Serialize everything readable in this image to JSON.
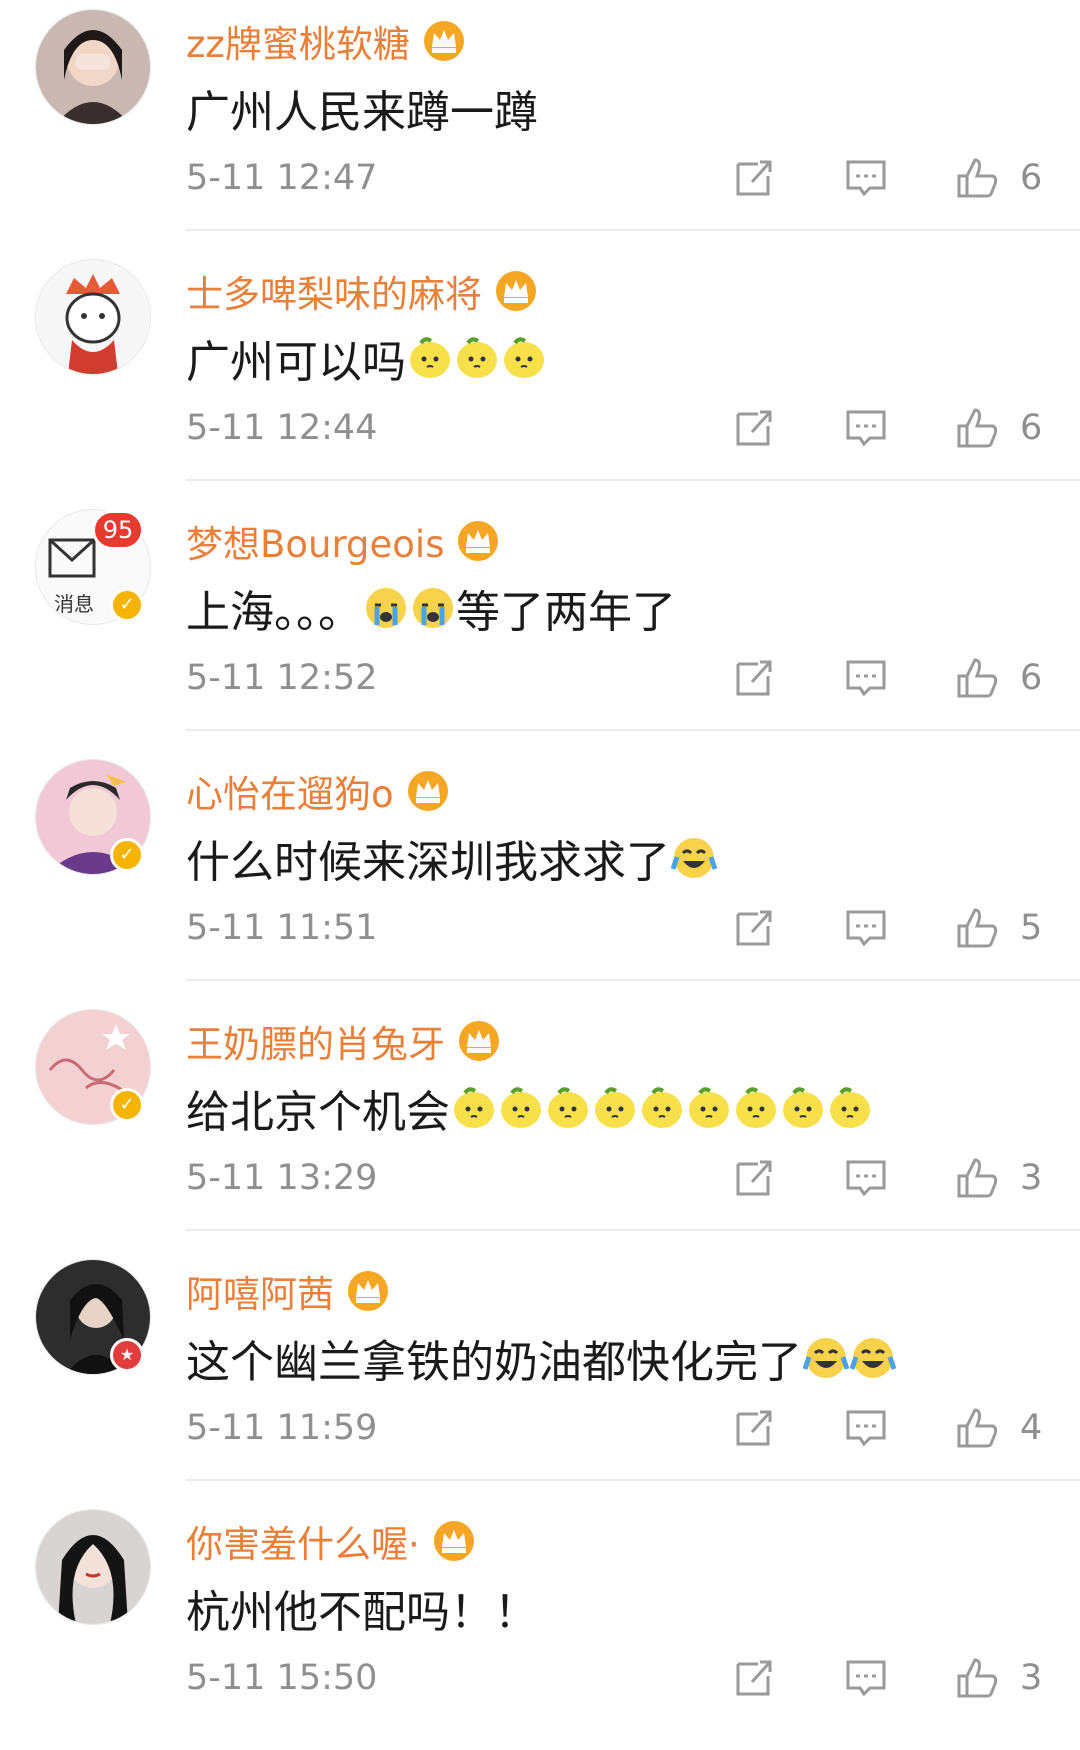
{
  "comments": [
    {
      "username": "zz牌蜜桃软糖",
      "crown_level": "1",
      "content": "广州人民来蹲一蹲",
      "emojis": [],
      "time": "5-11 12:47",
      "likes": "6",
      "avatar": "avatar-girl-covering-face",
      "badge": null
    },
    {
      "username": "士多啤梨味的麻将",
      "crown_level": "",
      "content": "广州可以吗",
      "emojis": [
        "lemon",
        "lemon",
        "lemon"
      ],
      "time": "5-11 12:44",
      "likes": "6",
      "avatar": "avatar-cartoon-king",
      "badge": null
    },
    {
      "username": "梦想Bourgeois",
      "crown_level": "2",
      "content": "上海。。。",
      "emojis": [
        "cry",
        "cry"
      ],
      "content_tail": "等了两年了",
      "time": "5-11 12:52",
      "likes": "6",
      "avatar": "avatar-messages",
      "avatar_label": "消息",
      "avatar_count": "95",
      "badge": "v"
    },
    {
      "username": "心怡在遛狗o",
      "crown_level": "4",
      "content": "什么时候来深圳我求求了",
      "emojis": [
        "laugh-cry"
      ],
      "time": "5-11 11:51",
      "likes": "5",
      "avatar": "avatar-illustration",
      "badge": "v"
    },
    {
      "username": "王奶膘的肖兔牙",
      "crown_level": "",
      "content": "给北京个机会",
      "emojis": [
        "lemon",
        "lemon",
        "lemon",
        "lemon",
        "lemon",
        "lemon",
        "lemon",
        "lemon",
        "lemon"
      ],
      "time": "5-11 13:29",
      "likes": "3",
      "avatar": "avatar-pink-handwriting",
      "badge": "v"
    },
    {
      "username": "阿嘻阿茜",
      "crown_level": "",
      "content": "这个幽兰拿铁的奶油都快化完了",
      "emojis": [
        "laugh-cry",
        "laugh-cry"
      ],
      "time": "5-11 11:59",
      "likes": "4",
      "avatar": "avatar-dark-portrait",
      "badge": "r"
    },
    {
      "username": "你害羞什么喔·",
      "crown_level": "2",
      "content": "杭州他不配吗！！",
      "emojis": [],
      "time": "5-11 15:50",
      "likes": "3",
      "avatar": "avatar-girl-portrait",
      "badge": null
    }
  ],
  "colors": {
    "username": "#e8803a",
    "text": "#1a1a1a",
    "meta": "#8f8f8f",
    "divider": "#ececec",
    "crown": "#f5a623"
  },
  "icons": {
    "share": "share-icon",
    "reply": "comment-icon",
    "like": "thumbs-up-icon"
  }
}
